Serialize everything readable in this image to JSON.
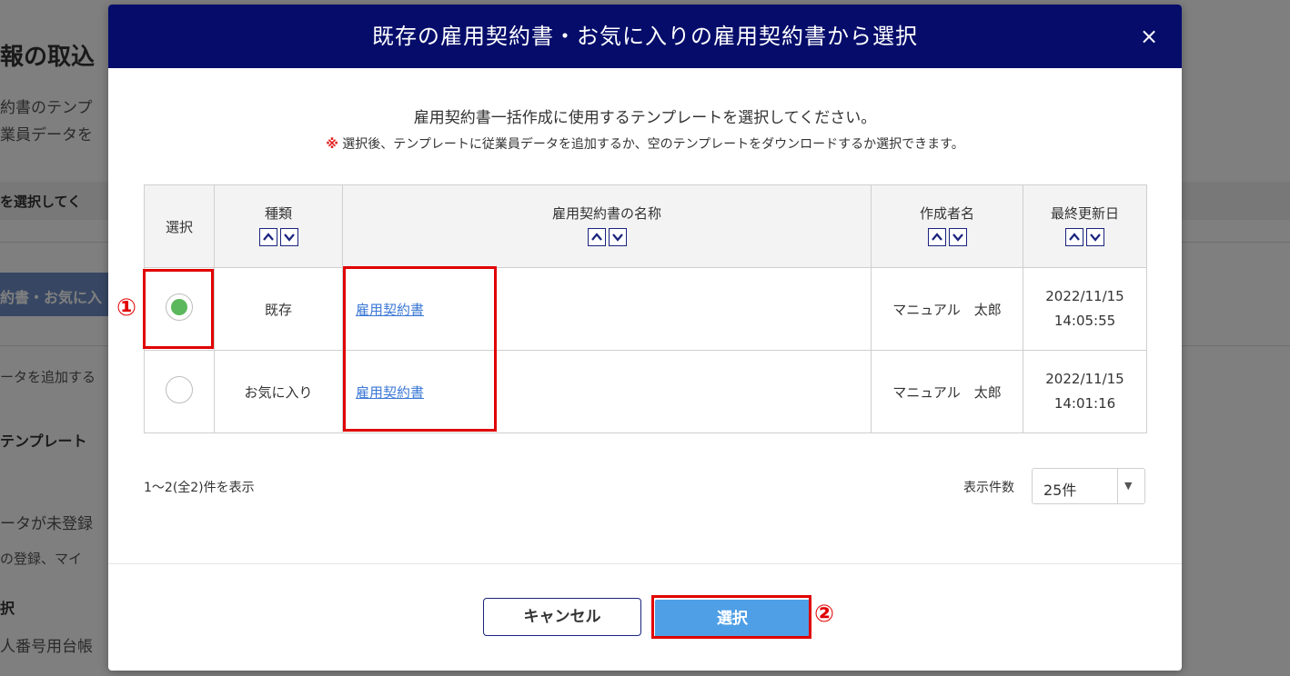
{
  "background": {
    "title": "報の取込",
    "line1": "約書のテンプ",
    "line2": "業員データを",
    "bar_text": "を選択してく",
    "blue_button": "約書・お気に入",
    "line3": "ータを追加する",
    "line4": "テンプレート",
    "line5": "ータが未登録",
    "line6": "の登録、マイ",
    "line7": "択",
    "line8": "人番号用台帳"
  },
  "modal": {
    "title": "既存の雇用契約書・お気に入りの雇用契約書から選択",
    "close_label": "×",
    "intro": "雇用契約書一括作成に使用するテンプレートを選択してください。",
    "note_mark": "※",
    "note": "選択後、テンプレートに従業員データを追加するか、空のテンプレートをダウンロードするか選択できます。"
  },
  "table": {
    "headers": {
      "select": "選択",
      "kind": "種類",
      "name": "雇用契約書の名称",
      "author": "作成者名",
      "updated": "最終更新日"
    },
    "rows": [
      {
        "selected": true,
        "kind": "既存",
        "name": "雇用契約書",
        "author": "マニュアル　太郎",
        "date": "2022/11/15",
        "time": "14:05:55"
      },
      {
        "selected": false,
        "kind": "お気に入り",
        "name": "雇用契約書",
        "author": "マニュアル　太郎",
        "date": "2022/11/15",
        "time": "14:01:16"
      }
    ]
  },
  "pagination": {
    "count_text": "1～2(全2)件を表示",
    "per_page_label": "表示件数",
    "per_page_value": "25件"
  },
  "buttons": {
    "cancel": "キャンセル",
    "select": "選択"
  },
  "annotations": {
    "marker1": "①",
    "marker2": "②"
  },
  "colors": {
    "header_bg": "#050c6a",
    "select_button": "#4f9fe6",
    "radio_checked": "#5cb85c",
    "highlight": "#e00000",
    "link": "#3b78d6"
  }
}
